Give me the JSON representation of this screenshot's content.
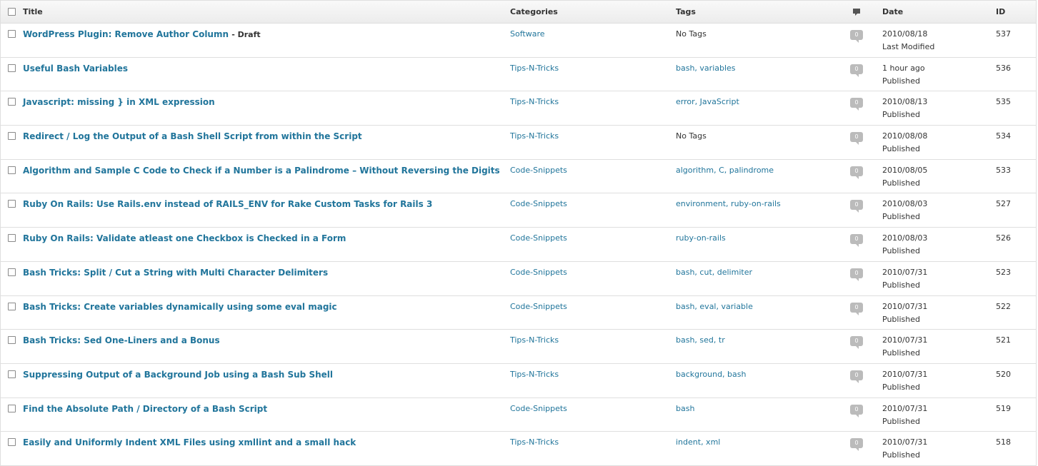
{
  "headers": {
    "title": "Title",
    "categories": "Categories",
    "tags": "Tags",
    "date": "Date",
    "id": "ID",
    "comments_icon": "comment-bubble-icon"
  },
  "rows": [
    {
      "title": "WordPress Plugin: Remove Author Column",
      "state": "- Draft",
      "category": "Software",
      "tags": "No Tags",
      "comments": "0",
      "date": "2010/08/18",
      "status": "Last Modified",
      "id": "537"
    },
    {
      "title": "Useful Bash Variables",
      "state": "",
      "category": "Tips-N-Tricks",
      "tags": "bash, variables",
      "comments": "0",
      "date": "1 hour ago",
      "status": "Published",
      "id": "536"
    },
    {
      "title": "Javascript: missing } in XML expression",
      "state": "",
      "category": "Tips-N-Tricks",
      "tags": "error, JavaScript",
      "comments": "0",
      "date": "2010/08/13",
      "status": "Published",
      "id": "535"
    },
    {
      "title": "Redirect / Log the Output of a Bash Shell Script from within the Script",
      "state": "",
      "category": "Tips-N-Tricks",
      "tags": "No Tags",
      "comments": "0",
      "date": "2010/08/08",
      "status": "Published",
      "id": "534"
    },
    {
      "title": "Algorithm and Sample C Code to Check if a Number is a Palindrome – Without Reversing the Digits",
      "state": "",
      "category": "Code-Snippets",
      "tags": "algorithm, C, palindrome",
      "comments": "0",
      "date": "2010/08/05",
      "status": "Published",
      "id": "533"
    },
    {
      "title": "Ruby On Rails: Use Rails.env instead of RAILS_ENV for Rake Custom Tasks for Rails 3",
      "state": "",
      "category": "Code-Snippets",
      "tags": "environment, ruby-on-rails",
      "comments": "0",
      "date": "2010/08/03",
      "status": "Published",
      "id": "527"
    },
    {
      "title": "Ruby On Rails: Validate atleast one Checkbox is Checked in a Form",
      "state": "",
      "category": "Code-Snippets",
      "tags": "ruby-on-rails",
      "comments": "0",
      "date": "2010/08/03",
      "status": "Published",
      "id": "526"
    },
    {
      "title": "Bash Tricks: Split / Cut a String with Multi Character Delimiters",
      "state": "",
      "category": "Code-Snippets",
      "tags": "bash, cut, delimiter",
      "comments": "0",
      "date": "2010/07/31",
      "status": "Published",
      "id": "523"
    },
    {
      "title": "Bash Tricks: Create variables dynamically using some eval magic",
      "state": "",
      "category": "Code-Snippets",
      "tags": "bash, eval, variable",
      "comments": "0",
      "date": "2010/07/31",
      "status": "Published",
      "id": "522"
    },
    {
      "title": "Bash Tricks: Sed One-Liners and a Bonus",
      "state": "",
      "category": "Tips-N-Tricks",
      "tags": "bash, sed, tr",
      "comments": "0",
      "date": "2010/07/31",
      "status": "Published",
      "id": "521"
    },
    {
      "title": "Suppressing Output of a Background Job using a Bash Sub Shell",
      "state": "",
      "category": "Tips-N-Tricks",
      "tags": "background, bash",
      "comments": "0",
      "date": "2010/07/31",
      "status": "Published",
      "id": "520"
    },
    {
      "title": "Find the Absolute Path / Directory of a Bash Script",
      "state": "",
      "category": "Code-Snippets",
      "tags": "bash",
      "comments": "0",
      "date": "2010/07/31",
      "status": "Published",
      "id": "519"
    },
    {
      "title": "Easily and Uniformly Indent XML Files using xmllint and a small hack",
      "state": "",
      "category": "Tips-N-Tricks",
      "tags": "indent, xml",
      "comments": "0",
      "date": "2010/07/31",
      "status": "Published",
      "id": "518"
    }
  ],
  "colors": {
    "link": "#21759b",
    "text": "#333333",
    "border": "#dfdfdf",
    "bubble": "#bbbbbb"
  }
}
